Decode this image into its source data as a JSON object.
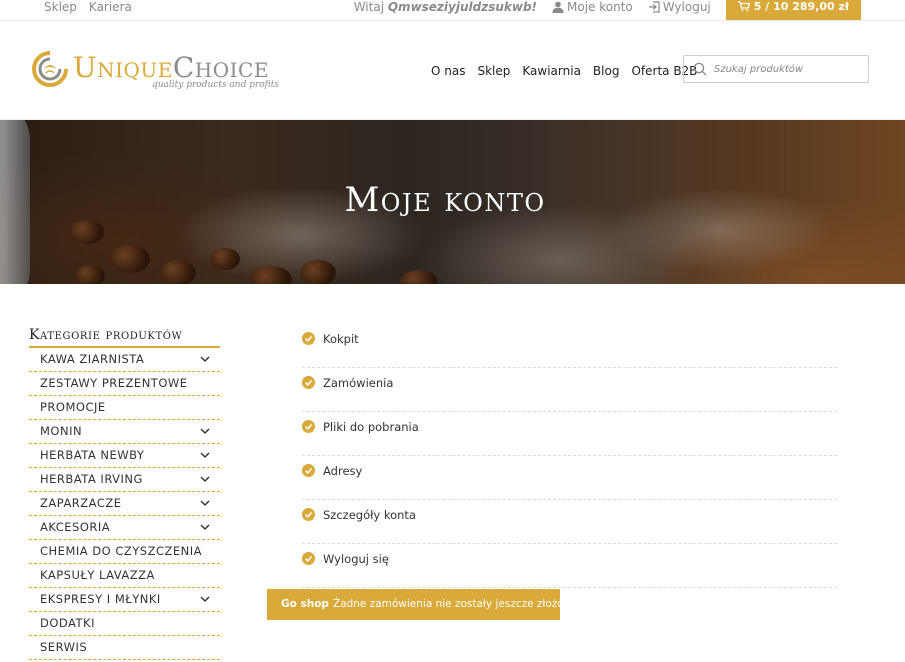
{
  "topbar": {
    "left_links": [
      "Sklep",
      "Kariera"
    ],
    "welcome_prefix": "Witaj",
    "username": "Qmwseziyjuldzsukwb!",
    "account_label": "Moje konto",
    "logout_label": "Wyloguj",
    "cart_text": "5 / 10 289,00 zł",
    "icons": {
      "account": "user-icon",
      "logout": "sign-out-icon",
      "cart": "cart-icon"
    }
  },
  "header": {
    "logo_word1": "Unique",
    "logo_word2": "Choice",
    "logo_tagline": "quality products and profits",
    "nav": [
      "O nas",
      "Sklep",
      "Kawiarnia",
      "Blog",
      "Oferta B2B"
    ],
    "search_placeholder": "Szukaj produktów"
  },
  "hero": {
    "title": "Moje konto"
  },
  "sidebar": {
    "title": "Kategorie produktów",
    "categories": [
      {
        "label": "Kawa ziarnista",
        "expandable": true
      },
      {
        "label": "Zestawy prezentowe",
        "expandable": false
      },
      {
        "label": "Promocje",
        "expandable": false
      },
      {
        "label": "Monin",
        "expandable": true
      },
      {
        "label": "Herbata Newby",
        "expandable": true
      },
      {
        "label": "Herbata Irving",
        "expandable": true
      },
      {
        "label": "Zaparzacze",
        "expandable": true
      },
      {
        "label": "Akcesoria",
        "expandable": true
      },
      {
        "label": "Chemia do czyszczenia",
        "expandable": false
      },
      {
        "label": "Kapsuły Lavazza",
        "expandable": false
      },
      {
        "label": "Ekspresy i młynki",
        "expandable": true
      },
      {
        "label": "Dodatki",
        "expandable": false
      },
      {
        "label": "Serwis",
        "expandable": false
      }
    ]
  },
  "account_menu": [
    "Kokpit",
    "Zamówienia",
    "Pliki do pobrania",
    "Adresy",
    "Szczegóły konta",
    "Wyloguj się"
  ],
  "notice": {
    "button_label": "Go shop",
    "message": "Żadne zamówienia nie zostały jeszcze złożone."
  },
  "colors": {
    "accent": "#d9a93a",
    "text": "#333333",
    "muted": "#8a8a8a"
  }
}
